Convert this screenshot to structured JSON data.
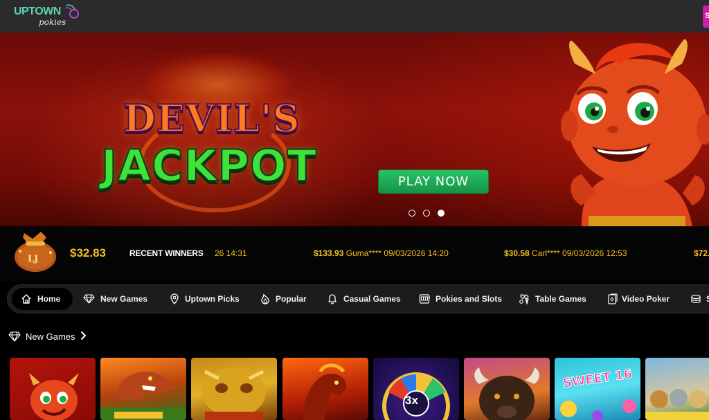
{
  "header": {
    "logo_main": "UPTOWN",
    "logo_sub": "pokies",
    "cta_label": "S"
  },
  "hero": {
    "title_line1": "DEVIL'S",
    "title_line2": "JACKPOT",
    "play_label": "PLAY NOW",
    "slide_count": 3,
    "active_slide": 3
  },
  "winners": {
    "jackpot_amount": "$32.83",
    "jackpot_bag_label": "LJ",
    "recent_label": "RECENT WINNERS",
    "entries": [
      {
        "text": "26 14:31"
      },
      {
        "amount": "$133.93",
        "text": " Guma**** 09/03/2026 14:20"
      },
      {
        "amount": "$30.58",
        "text": " Carl**** 09/03/2026 12:53"
      },
      {
        "amount": "$72.",
        "text": ""
      }
    ]
  },
  "nav": {
    "items": [
      {
        "label": "Home",
        "icon": "home-icon"
      },
      {
        "label": "New Games",
        "icon": "diamond-icon"
      },
      {
        "label": "Uptown Picks",
        "icon": "location-pin-icon"
      },
      {
        "label": "Popular",
        "icon": "flame-icon"
      },
      {
        "label": "Casual Games",
        "icon": "bell-icon"
      },
      {
        "label": "Pokies and Slots",
        "icon": "slot-machine-icon"
      },
      {
        "label": "Table Games",
        "icon": "cards-icon"
      },
      {
        "label": "Video Poker",
        "icon": "video-poker-icon"
      },
      {
        "label": "S",
        "icon": "chips-icon"
      }
    ]
  },
  "new_games": {
    "title": "New Games",
    "tiles": [
      "",
      "",
      "",
      "",
      "",
      "",
      "",
      ""
    ],
    "tile5_badge": "3x",
    "tile7_badge": "SWEET 16"
  },
  "colors": {
    "accent_gold": "#f3c11d",
    "play_green": "#1fae55",
    "brand_teal": "#5fd3b0",
    "hero_red": "#8a110a"
  }
}
